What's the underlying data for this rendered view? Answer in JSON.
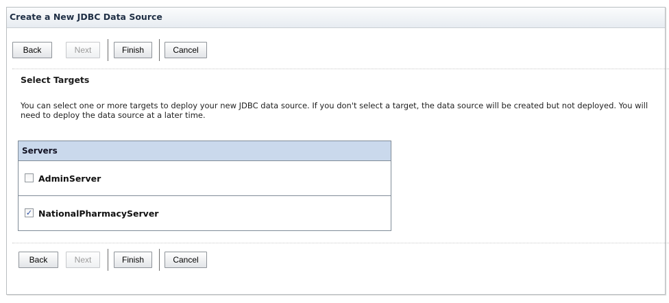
{
  "dialog": {
    "title": "Create a New JDBC Data Source"
  },
  "buttons": {
    "back": "Back",
    "next": "Next",
    "finish": "Finish",
    "cancel": "Cancel"
  },
  "section": {
    "heading": "Select Targets",
    "description": "You can select one or more targets to deploy your new JDBC data source. If you don't select a target, the data source will be created but not deployed. You will need to deploy the data source at a later time."
  },
  "servers_table": {
    "header": "Servers",
    "rows": [
      {
        "name": "AdminServer",
        "checked": false,
        "check_glyph": ""
      },
      {
        "name": "NationalPharmacyServer",
        "checked": true,
        "check_glyph": "✓"
      }
    ]
  }
}
